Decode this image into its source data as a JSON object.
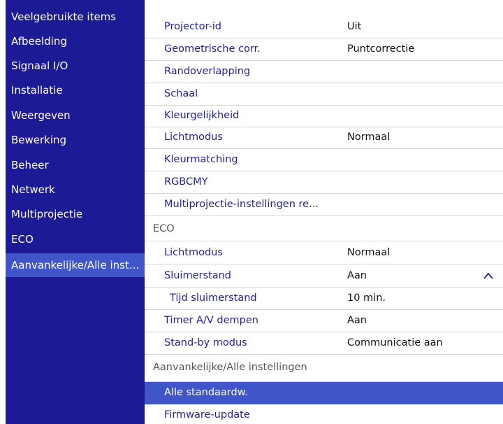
{
  "sidebar": {
    "items": [
      {
        "label": "Veelgebruikte items"
      },
      {
        "label": "Afbeelding"
      },
      {
        "label": "Signaal I/O"
      },
      {
        "label": "Installatie"
      },
      {
        "label": "Weergeven"
      },
      {
        "label": "Bewerking"
      },
      {
        "label": "Beheer"
      },
      {
        "label": "Netwerk"
      },
      {
        "label": "Multiprojectie"
      },
      {
        "label": "ECO"
      },
      {
        "label": "Aanvankelijke/Alle inst...",
        "active": true
      }
    ]
  },
  "settings": {
    "rows": [
      {
        "label": "Projector-id",
        "value": "Uit"
      },
      {
        "label": "Geometrische corr.",
        "value": "Puntcorrectie"
      },
      {
        "label": "Randoverlapping",
        "value": ""
      },
      {
        "label": "Schaal",
        "value": ""
      },
      {
        "label": "Kleurgelijkheid",
        "value": ""
      },
      {
        "label": "Lichtmodus",
        "value": "Normaal"
      },
      {
        "label": "Kleurmatching",
        "value": ""
      },
      {
        "label": "RGBCMY",
        "value": ""
      },
      {
        "label": "Multiprojectie-instellingen re...",
        "value": ""
      },
      {
        "label": "ECO",
        "value": "",
        "section": true
      },
      {
        "label": "Lichtmodus",
        "value": "Normaal"
      },
      {
        "label": "Sluimerstand",
        "value": "Aan",
        "expanded": true
      },
      {
        "label": "Tijd sluimerstand",
        "value": "10 min.",
        "sub": true
      },
      {
        "label": "Timer A/V dempen",
        "value": "Aan"
      },
      {
        "label": "Stand-by modus",
        "value": "Communicatie aan"
      },
      {
        "label": "Aanvankelijke/Alle instellingen",
        "value": "",
        "section": true
      },
      {
        "label": "Alle standaardw.",
        "value": "",
        "selected": true
      },
      {
        "label": "Firmware-update",
        "value": ""
      }
    ]
  },
  "colors": {
    "sidebar_bg": "#1d1a96",
    "highlight": "#4055c8",
    "item_text": "#22229a"
  }
}
